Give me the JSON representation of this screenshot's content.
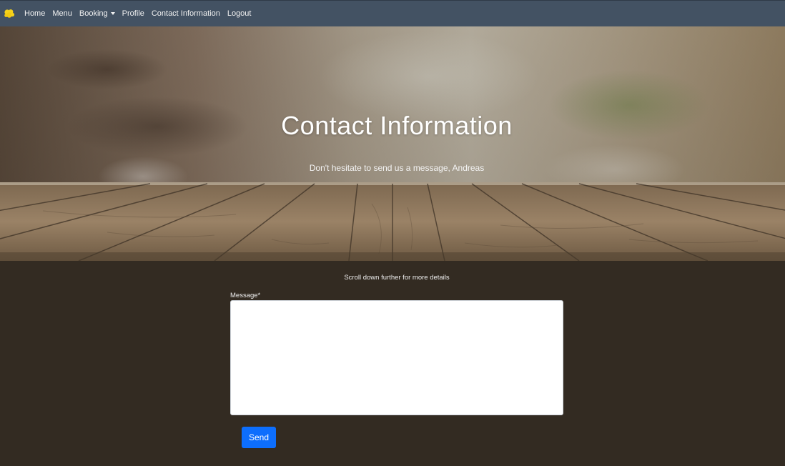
{
  "navbar": {
    "brand_icon": "lemon-logo-icon",
    "brand_color": "#f5d21b",
    "background": "#435263",
    "items": [
      {
        "label": "Home"
      },
      {
        "label": "Menu"
      },
      {
        "label": "Booking",
        "dropdown": true
      },
      {
        "label": "Profile"
      },
      {
        "label": "Contact Information"
      },
      {
        "label": "Logout"
      }
    ]
  },
  "hero": {
    "title": "Contact Information",
    "subtitle": "Don't hesitate to send us a message, Andreas"
  },
  "content": {
    "background": "#332b22",
    "scroll_hint": "Scroll down further for more details",
    "message_label": "Message*",
    "message_value": "",
    "send_label": "Send",
    "send_color": "#0d6efd"
  }
}
